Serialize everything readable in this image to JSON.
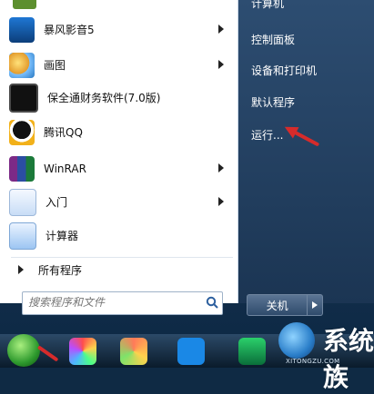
{
  "start_menu": {
    "left_items": [
      {
        "label": "暴风影音5",
        "icon": "baofeng-icon",
        "has_submenu": true
      },
      {
        "label": "画图",
        "icon": "paint-icon",
        "has_submenu": true
      },
      {
        "label": "保全通财务软件(7.0版)",
        "icon": "finance-software-icon",
        "has_submenu": false
      },
      {
        "label": "腾讯QQ",
        "icon": "qq-icon",
        "has_submenu": false
      },
      {
        "label": "WinRAR",
        "icon": "winrar-icon",
        "has_submenu": true
      },
      {
        "label": "入门",
        "icon": "getting-started-icon",
        "has_submenu": true
      },
      {
        "label": "计算器",
        "icon": "calculator-icon",
        "has_submenu": false
      }
    ],
    "all_programs_label": "所有程序",
    "search_placeholder": "搜索程序和文件",
    "right_items": {
      "computer_cut": "计算机",
      "control_panel": "控制面板",
      "devices_printers": "设备和打印机",
      "default_programs": "默认程序",
      "run": "运行..."
    },
    "shutdown_label": "关机"
  },
  "watermark": {
    "brand": "系统族",
    "url": "XITONGZU.COM"
  },
  "colors": {
    "menu_right_bg": "#1b3553",
    "menu_left_bg": "#ffffff",
    "taskbar_bg": "#0a1b2b",
    "callout_red": "#d62b2b"
  }
}
